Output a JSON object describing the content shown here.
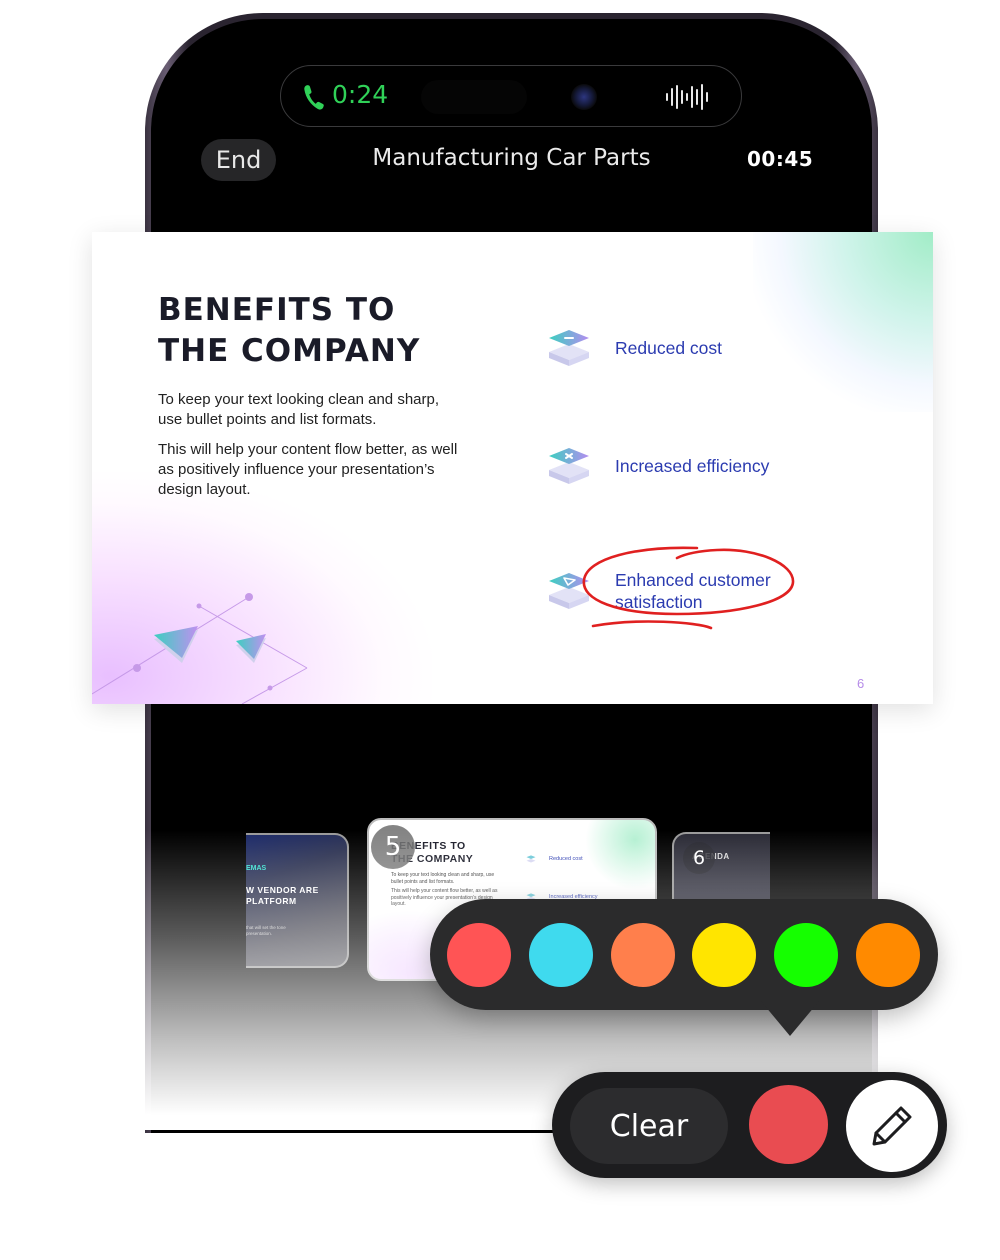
{
  "call": {
    "duration": "0:24",
    "end_label": "End",
    "title": "Manufacturing Car Parts",
    "timer": "00:45",
    "accent_color": "#30d158"
  },
  "slide": {
    "title": "Benefits to the Company",
    "paragraphs": [
      "To keep your text looking clean and sharp, use bullet points and list formats.",
      "This will help your content flow better, as well as positively influence your presentation’s design layout."
    ],
    "benefits": [
      {
        "label": "Reduced cost",
        "icon": "minus-layer-icon"
      },
      {
        "label": "Increased efficiency",
        "icon": "multiply-layer-icon"
      },
      {
        "label": "Enhanced customer satisfaction",
        "icon": "play-layer-icon",
        "annotated": true
      }
    ],
    "page_number": "6",
    "text_color": "#2b3bb0",
    "annotation_color": "#e02020"
  },
  "thumbnails": [
    {
      "tag": "EMAS",
      "title": "W VENDOR ARE PLATFORM",
      "subtitle": "that will set the tone presentation."
    },
    {
      "number": "5",
      "title": "Benefits to the Company",
      "paragraphs": [
        "To keep your text looking clean and sharp, use bullet points and list formats.",
        "This will help your content flow better, as well as positively influence your presentation’s design layout."
      ],
      "benefits": [
        "Reduced cost",
        "Increased efficiency"
      ]
    },
    {
      "number": "6",
      "title": "AGENDA"
    }
  ],
  "palette": {
    "colors": [
      "#ff5455",
      "#3fdaee",
      "#ff7f4c",
      "#ffe500",
      "#15ff00",
      "#ff8a00"
    ]
  },
  "toolbar": {
    "clear_label": "Clear",
    "current_color": "#e94c51",
    "tool": "pencil-icon"
  }
}
